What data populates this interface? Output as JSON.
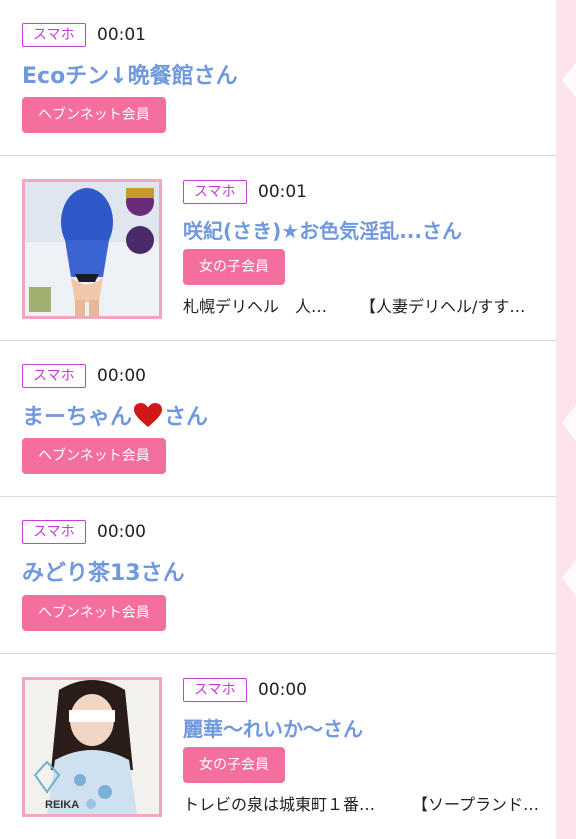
{
  "badge_label": "スマホ",
  "member_colors": {
    "accent": "#f46f9d",
    "name": "#6f98df",
    "badge": "#c43ed8"
  },
  "items": [
    {
      "time": "00:01",
      "name": "Ecoチン↓晩餐館さん",
      "member": "ヘブンネット会員"
    },
    {
      "time": "00:01",
      "name": "咲紀(さき)★お色気淫乱...さん",
      "member": "女の子会員",
      "shop": "札幌デリヘル　人…",
      "category": "【人妻デリヘル/すす…"
    },
    {
      "time": "00:00",
      "name": "まーちゃん",
      "name_suffix": "さん",
      "member": "ヘブンネット会員"
    },
    {
      "time": "00:00",
      "name": "みどり茶13さん",
      "member": "ヘブンネット会員"
    },
    {
      "time": "00:00",
      "name": "麗華〜れいか〜さん",
      "member": "女の子会員",
      "shop": "トレビの泉は城東町１番…",
      "category": "【ソープランド…",
      "thumb_text": "REIKA"
    }
  ]
}
